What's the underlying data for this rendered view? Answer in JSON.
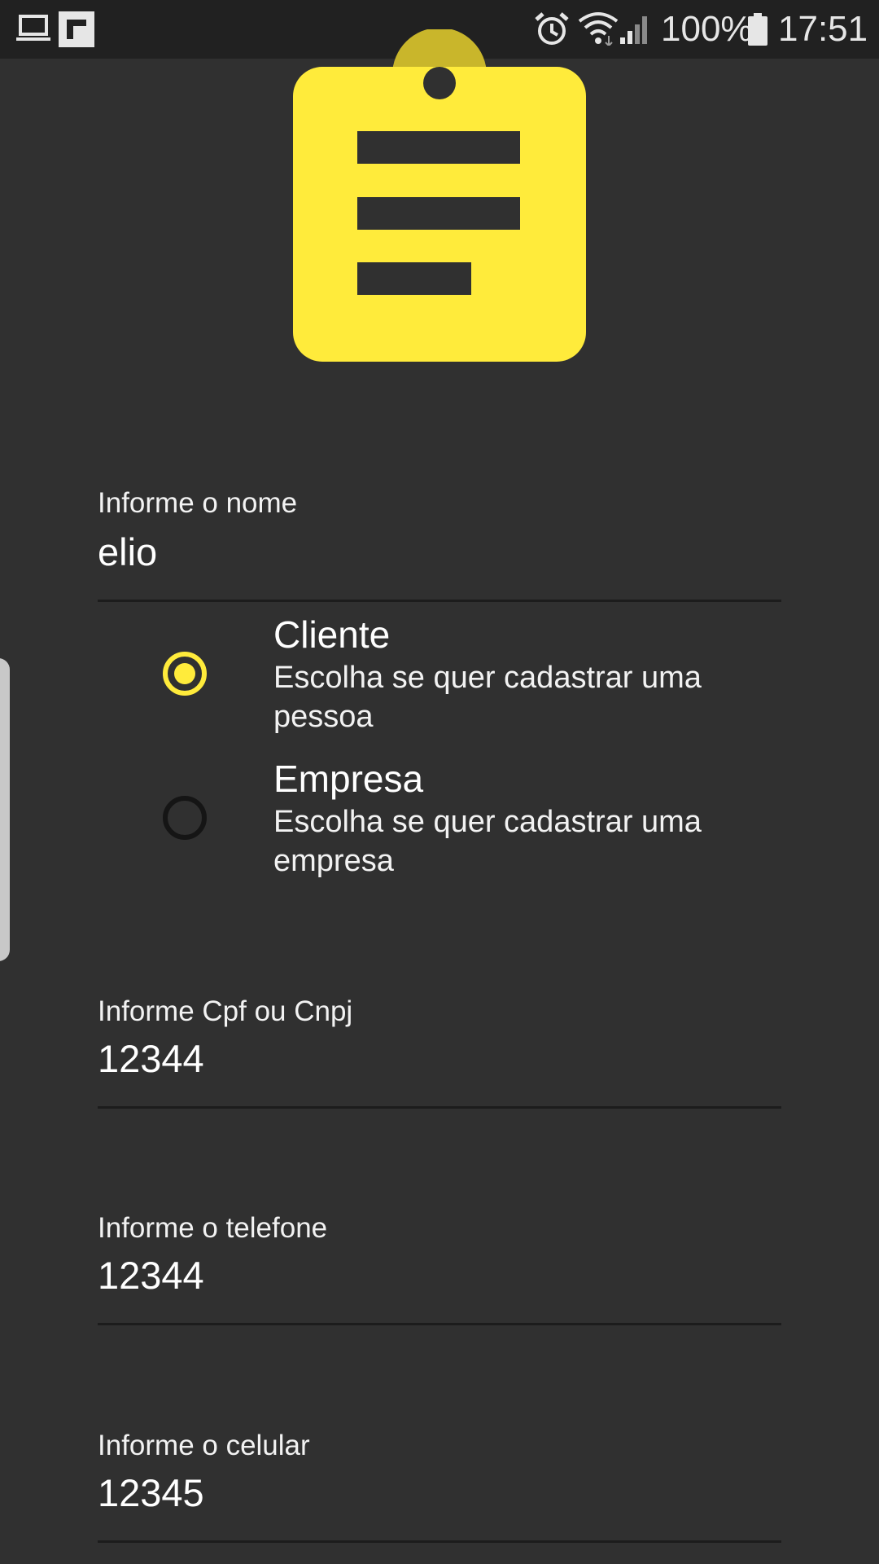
{
  "status_bar": {
    "battery": "100%",
    "time": "17:51",
    "left_icons": [
      "laptop-icon",
      "flipboard-icon"
    ],
    "right_icons": [
      "alarm-icon",
      "wifi-icon",
      "signal-icon",
      "battery-icon"
    ]
  },
  "colors": {
    "background": "#303030",
    "status_bar": "#212121",
    "accent": "#ffeb3b",
    "underline": "#1c1c1c"
  },
  "form": {
    "nome": {
      "label": "Informe o nome",
      "value": "elio"
    },
    "tipo": {
      "options": [
        {
          "title": "Cliente",
          "description": "Escolha se quer cadastrar uma pessoa",
          "selected": true
        },
        {
          "title": "Empresa",
          "description": "Escolha se quer cadastrar uma empresa",
          "selected": false
        }
      ]
    },
    "documento": {
      "label": "Informe Cpf ou Cnpj",
      "value": "12344"
    },
    "telefone": {
      "label": "Informe o telefone",
      "value": "12344"
    },
    "celular": {
      "label": "Informe o celular",
      "value": "12345"
    }
  }
}
